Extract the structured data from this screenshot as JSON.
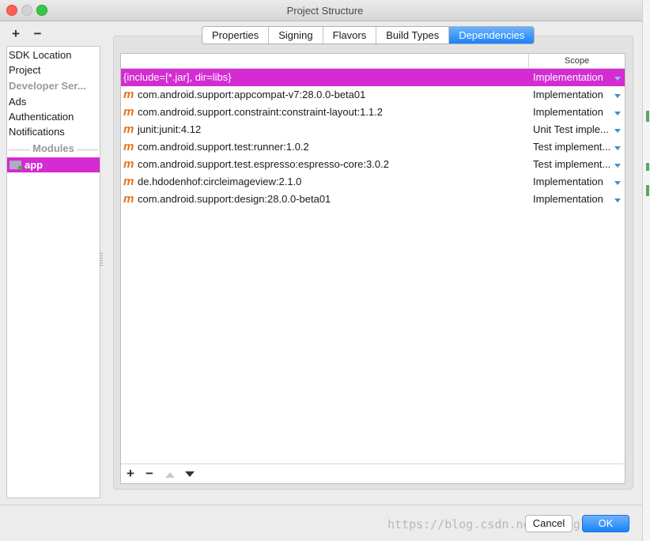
{
  "window": {
    "title": "Project Structure"
  },
  "sidebar": {
    "add_label": "+",
    "remove_label": "−",
    "items": [
      {
        "label": "SDK Location"
      },
      {
        "label": "Project"
      },
      {
        "label": "Developer Ser..."
      },
      {
        "label": "Ads"
      },
      {
        "label": "Authentication"
      },
      {
        "label": "Notifications"
      }
    ],
    "modules_heading": "Modules",
    "modules": [
      {
        "label": "app"
      }
    ]
  },
  "tabs": [
    {
      "label": "Properties"
    },
    {
      "label": "Signing"
    },
    {
      "label": "Flavors"
    },
    {
      "label": "Build Types"
    },
    {
      "label": "Dependencies"
    }
  ],
  "table": {
    "scope_header": "Scope",
    "rows": [
      {
        "name": "{include=[*.jar], dir=libs}",
        "scope": "Implementation",
        "icon": ""
      },
      {
        "name": "com.android.support:appcompat-v7:28.0.0-beta01",
        "scope": "Implementation",
        "icon": "m"
      },
      {
        "name": "com.android.support.constraint:constraint-layout:1.1.2",
        "scope": "Implementation",
        "icon": "m"
      },
      {
        "name": "junit:junit:4.12",
        "scope": "Unit Test imple...",
        "icon": "m"
      },
      {
        "name": "com.android.support.test:runner:1.0.2",
        "scope": "Test implement...",
        "icon": "m"
      },
      {
        "name": "com.android.support.test.espresso:espresso-core:3.0.2",
        "scope": "Test implement...",
        "icon": "m"
      },
      {
        "name": "de.hdodenhof:circleimageview:2.1.0",
        "scope": "Implementation",
        "icon": "m"
      },
      {
        "name": "com.android.support:design:28.0.0-beta01",
        "scope": "Implementation",
        "icon": "m"
      }
    ],
    "toolbar": {
      "add": "+",
      "remove": "−"
    }
  },
  "footer": {
    "cancel_label": "Cancel",
    "ok_label": "OK",
    "watermark": "https://blog.csdn.net/huanglei_ear"
  }
}
